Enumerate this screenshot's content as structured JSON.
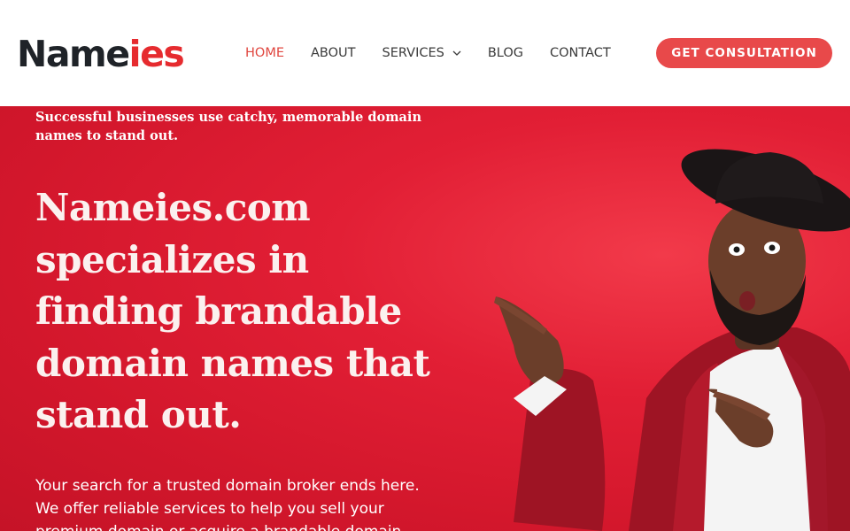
{
  "brand": {
    "logo_part_a": "Name",
    "logo_part_b": "ies",
    "colors": {
      "accent": "#e62b2f",
      "dark": "#1f2328",
      "cta": "#e8494a",
      "hero": "#d91c31"
    }
  },
  "nav": {
    "items": [
      {
        "label": "HOME",
        "active": true
      },
      {
        "label": "ABOUT",
        "active": false
      },
      {
        "label": "SERVICES",
        "active": false,
        "icon": "chevron-down-icon"
      },
      {
        "label": "BLOG",
        "active": false
      },
      {
        "label": "CONTACT",
        "active": false
      }
    ],
    "cta_label": "GET CONSULTATION"
  },
  "hero": {
    "tagline": "Successful businesses use catchy, memorable domain names to stand out.",
    "headline": "Nameies.com specializes in finding brandable domain names that stand out.",
    "body": "Your search for a trusted domain broker ends here. We offer reliable services to help you sell your premium domain or acquire a brandable domain."
  }
}
